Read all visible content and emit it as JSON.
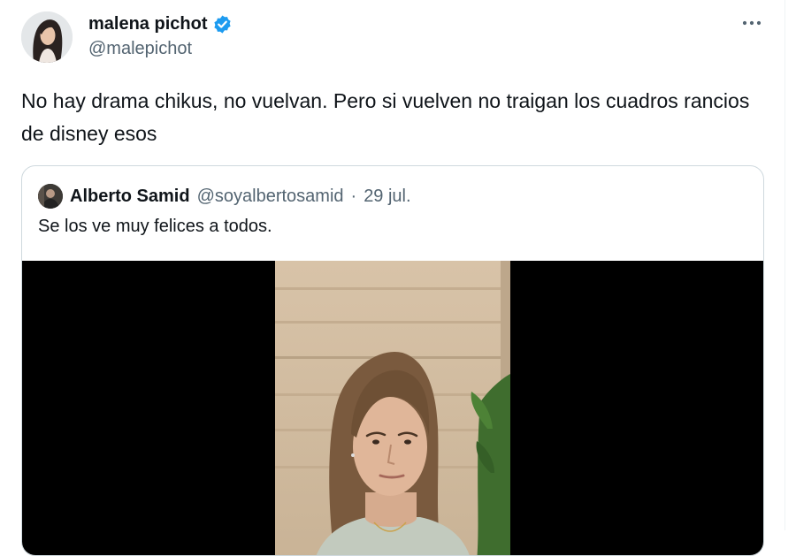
{
  "tweet": {
    "author": {
      "name": "malena pichot",
      "handle": "@malepichot",
      "verified_icon": "verified-badge-icon",
      "verified_color": "#1d9bf0"
    },
    "more_icon": "more-options-icon",
    "text": "No hay drama chikus, no vuelvan. Pero si vuelven no traigan los cuadros rancios de disney esos"
  },
  "quote": {
    "author": {
      "name": "Alberto Samid",
      "handle": "@soyalbertosamid",
      "separator": "·",
      "date": "29 jul."
    },
    "text": "Se los ve muy felices a todos."
  },
  "colors": {
    "text": "#0f1419",
    "secondary": "#536471",
    "border": "#cfd9de",
    "accent": "#1d9bf0"
  }
}
